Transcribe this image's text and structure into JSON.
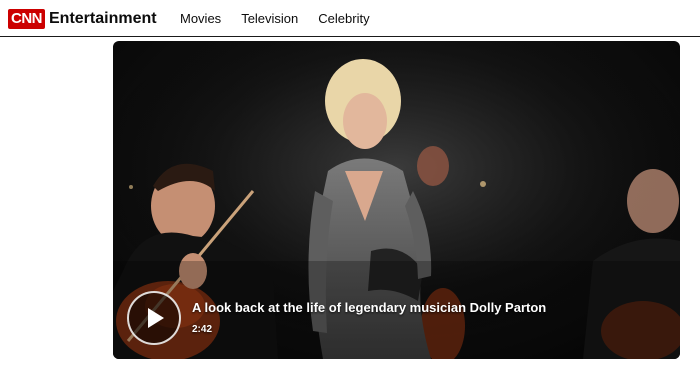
{
  "header": {
    "logo_text": "CNN",
    "section_title": "Entertainment",
    "nav": [
      "Movies",
      "Television",
      "Celebrity"
    ]
  },
  "video": {
    "title": "A look back at the life of legendary musician Dolly Parton",
    "duration": "2:42",
    "play_icon": "play-icon"
  },
  "colors": {
    "brand_red": "#cc0000",
    "text": "#0c0c0c"
  }
}
